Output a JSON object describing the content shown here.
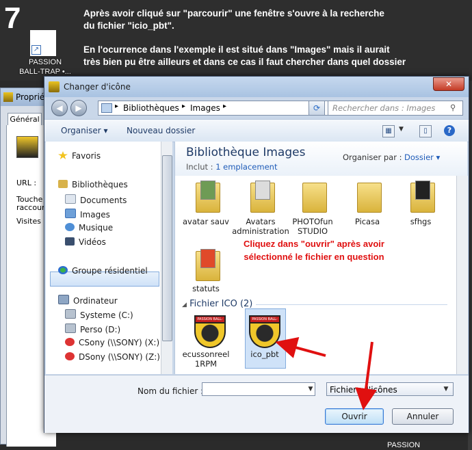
{
  "banner": {
    "step": "7",
    "line1": "Après avoir cliqué sur \"parcourir\" une fenêtre s'ouvre à la recherche",
    "line2": "du fichier \"icio_pbt\".",
    "line3": "En l'ocurrence dans l'exemple il est situé dans \"Images\" mais il aurait",
    "line4": "très bien pu être ailleurs et dans ce cas il faut chercher dans quel dossier",
    "desktop_label1": "PASSION",
    "desktop_label2": "BALL-TRAP •..."
  },
  "background_window": {
    "title": "Proprié",
    "tab": "Général",
    "url_label": "URL :",
    "shortcut_label1": "Touche",
    "shortcut_label2": "raccour",
    "visits_label": "Visites :"
  },
  "dialog": {
    "title": "Changer d'icône",
    "close": "✕",
    "address": {
      "root": "Bibliothèques",
      "current": "Images"
    },
    "search_placeholder": "Rechercher dans : Images",
    "toolbar": {
      "organize": "Organiser ▾",
      "new_folder": "Nouveau dossier"
    },
    "nav": {
      "favorites": "Favoris",
      "libraries": "Bibliothèques",
      "documents": "Documents",
      "images": "Images",
      "music": "Musique",
      "videos": "Vidéos",
      "homegroup": "Groupe résidentiel",
      "computer": "Ordinateur",
      "drive_c": "Systeme (C:)",
      "drive_d": "Perso (D:)",
      "drive_x": "CSony (\\\\SONY) (X:)",
      "drive_z": "DSony (\\\\SONY) (Z:)"
    },
    "library": {
      "title": "Bibliothèque Images",
      "includes_label": "Inclut :",
      "includes_link": "1 emplacement",
      "arrange_label": "Organiser par :",
      "arrange_value": "Dossier ▾"
    },
    "folders": [
      {
        "name": "avatar sauv"
      },
      {
        "name": "Avatars administration"
      },
      {
        "name": "PHOTOfun STUDIO"
      },
      {
        "name": "Picasa"
      },
      {
        "name": "sfhgs"
      },
      {
        "name": "statuts"
      }
    ],
    "group_header": "Fichier ICO (2)",
    "ico_files": [
      {
        "name": "ecussonreel 1RPM",
        "badge": "PASSION BALL-TRAP"
      },
      {
        "name": "ico_pbt",
        "badge": "PASSION BALL-TRAP"
      }
    ],
    "filename_label": "Nom du fichier :",
    "filename_value": "",
    "filetype_value": "Fichiers d'icônes",
    "open_button": "Ouvrir",
    "cancel_button": "Annuler"
  },
  "annotation": {
    "line1": "Cliquez dans \"ouvrir\" après avoir",
    "line2": "sélectionné le fichier en question"
  },
  "desktop_bottom_label": "PASSION",
  "colors": {
    "annotation": "#e01010",
    "title_text": "#1e3a66",
    "selection": "#cfe2f8"
  }
}
